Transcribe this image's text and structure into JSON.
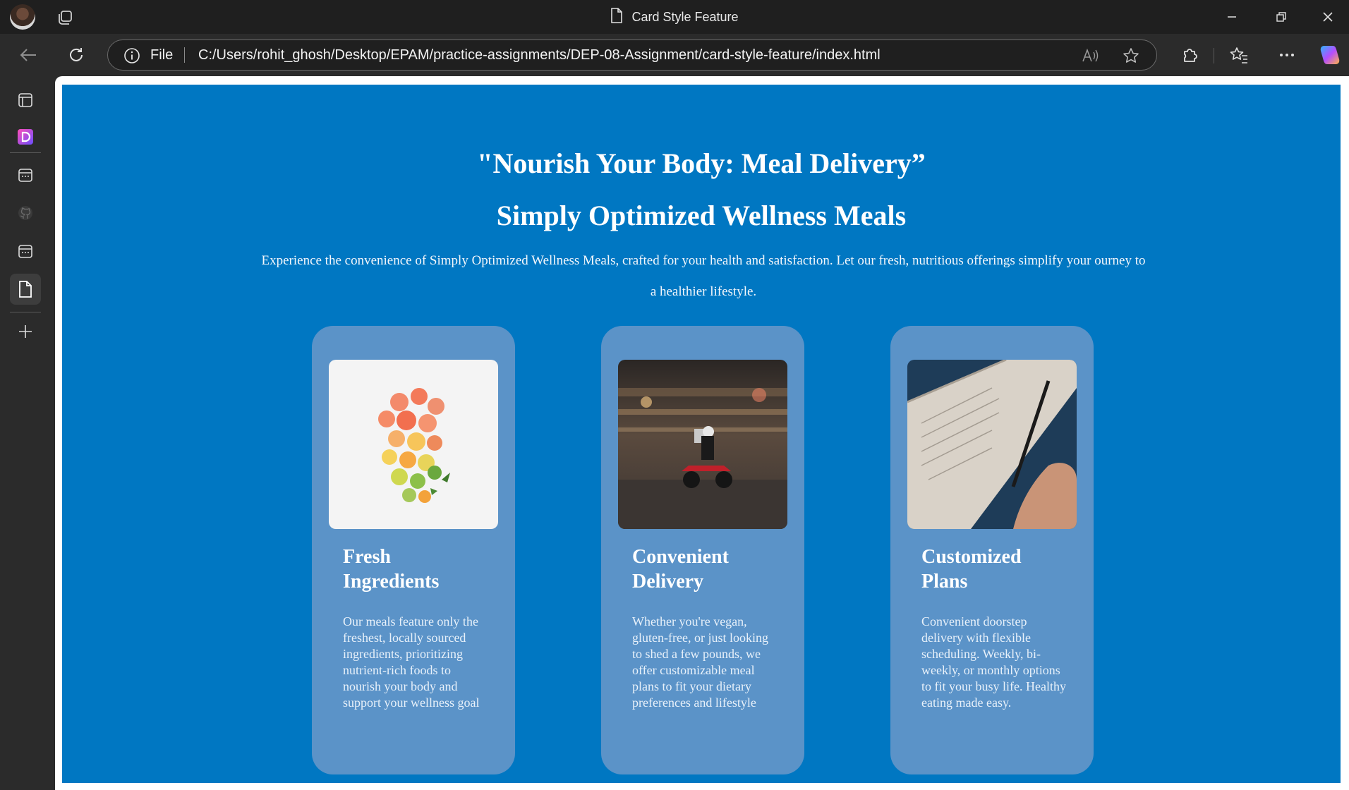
{
  "window": {
    "title": "Card Style Feature"
  },
  "address_bar": {
    "scheme_label": "File",
    "url": "C:/Users/rohit_ghosh/Desktop/EPAM/practice-assignments/DEP-08-Assignment/card-style-feature/index.html"
  },
  "page": {
    "heading": "\"Nourish Your Body: Meal Delivery”",
    "subheading": "Simply Optimized Wellness Meals",
    "description": "Experience the convenience of Simply Optimized Wellness Meals, crafted for your health and satisfaction. Let our fresh, nutritious offerings simplify your ourney to a healthier lifestyle.",
    "cards": [
      {
        "title": "Fresh Ingredients",
        "text": "Our meals feature only the freshest, locally sourced ingredients, prioritizing nutrient-rich foods to nourish your body and support your wellness goal"
      },
      {
        "title": "Convenient Delivery",
        "text": "Whether you're vegan, gluten-free, or just looking to shed a few pounds, we offer customizable meal plans to fit your dietary preferences and lifestyle"
      },
      {
        "title": "Customized Plans",
        "text": "Convenient doorstep delivery with flexible scheduling. Weekly, bi-weekly, or monthly options to fit your busy life. Healthy eating made easy."
      }
    ]
  },
  "colors": {
    "page_bg": "#0077c2",
    "card_bg": "#5b93c8",
    "chrome_bg": "#2b2b2b"
  }
}
